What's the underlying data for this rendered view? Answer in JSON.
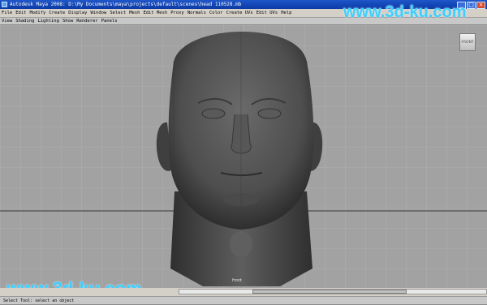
{
  "window": {
    "title": "Autodesk Maya 2008: D:\\My Documents\\maya\\projects\\default\\scenes\\head 110528.mb",
    "buttons": [
      "_",
      "□",
      "×"
    ]
  },
  "menubar": {
    "items": [
      "File",
      "Edit",
      "Modify",
      "Create",
      "Display",
      "Window",
      "Select",
      "Mesh",
      "Edit Mesh",
      "Proxy",
      "Normals",
      "Color",
      "Create UVs",
      "Edit UVs",
      "Help"
    ]
  },
  "panel_menu": {
    "items": [
      "View",
      "Shading",
      "Lighting",
      "Show",
      "Renderer",
      "Panels"
    ]
  },
  "viewport": {
    "camera_label": "FRONT",
    "view_label": "front",
    "background_color": "#a2a2a2",
    "model_color": "#4e4e4e"
  },
  "watermarks": {
    "top": "www.3d-ku.com",
    "bottom": "www.3d-ku.com"
  },
  "help_line": {
    "text": "Select Tool: select an object"
  }
}
